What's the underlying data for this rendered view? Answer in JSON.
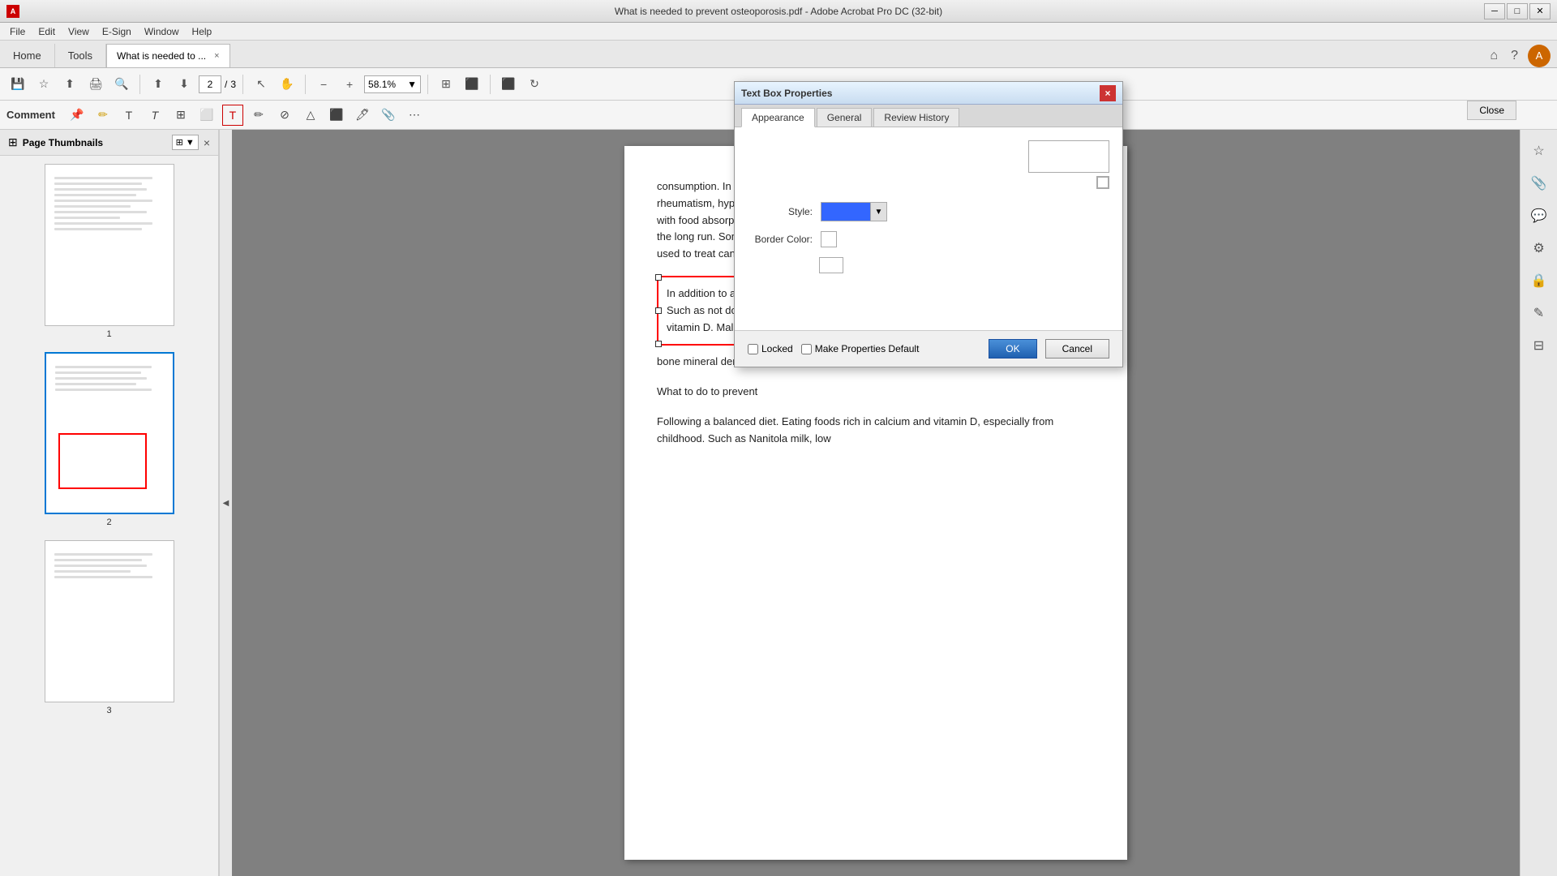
{
  "window": {
    "title": "What is needed to prevent osteoporosis.pdf - Adobe Acrobat Pro DC (32-bit)",
    "app_icon": "A",
    "controls": [
      "minimize",
      "maximize",
      "close"
    ]
  },
  "menu": {
    "items": [
      "File",
      "Edit",
      "View",
      "E-Sign",
      "Window",
      "Help"
    ]
  },
  "tabs": {
    "home": "Home",
    "tools": "Tools",
    "doc_tab": "What is needed to ...",
    "close_label": "×"
  },
  "toolbar": {
    "page_current": "2",
    "page_total": "3",
    "zoom": "58.1%"
  },
  "comment_toolbar": {
    "label": "Comment"
  },
  "sidebar": {
    "title": "Page Thumbnails",
    "close": "×",
    "pages": [
      {
        "number": "1",
        "active": false
      },
      {
        "number": "2",
        "active": true
      },
      {
        "number": "3",
        "active": false
      }
    ]
  },
  "pdf": {
    "paragraph1": "consumption. In addition, some diseases increase the risk of osteoporosis. Such as rheumatism, hypogonadism, thyroid or parathyroid hormone problems; Diseases that interfere with food absorption, such as celiac disease and Crohn's disease. If someone is bedridden in the long run. Some drugs also increase bone loss. Such as steroids, anticonvulsants, drugs used to treat cancer.",
    "textbox_content": "In addition to aging and menopause, there are other causes and risks of osteoporosis. Such as not doing adequate amount of physical exertion. Not getting enough calcium and vitamin D. Malnutrition and underweight. Excessive smoking or alcohol consumption.",
    "partial_text": "bone mineral density of a patient at risk.",
    "section_title": "What to do to prevent",
    "paragraph2": "Following a balanced diet. Eating foods rich in calcium and vitamin D, especially from childhood. Such as Nanitola milk, low"
  },
  "dialog": {
    "title": "Text Box Properties",
    "close_btn": "×",
    "tabs": [
      "Appearance",
      "General",
      "Review History"
    ],
    "active_tab": "Appearance",
    "style_label": "Style:",
    "border_color_label": "Border Color:",
    "style_color": "#3366ff",
    "locked_label": "Locked",
    "make_default_label": "Make Properties Default",
    "ok_label": "OK",
    "cancel_label": "Cancel"
  },
  "right_panel": {
    "close_label": "Close"
  },
  "icons": {
    "save": "💾",
    "bookmark": "☆",
    "upload": "⬆",
    "print": "🖨",
    "search_zoom": "🔍",
    "prev_page": "⬆",
    "next_page": "⬇",
    "cursor": "↖",
    "hand": "✋",
    "zoom_out": "−",
    "zoom_in": "+",
    "fit": "⊞",
    "tools1": "⬛",
    "tools2": "⬛",
    "chevron_down": "▼",
    "chevron_up": "▲"
  }
}
